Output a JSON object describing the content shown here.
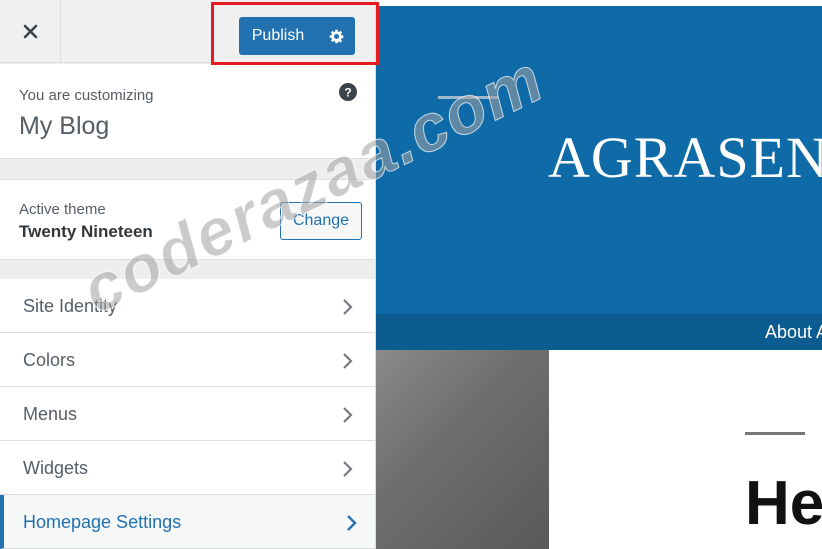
{
  "header": {
    "close_icon": "close-icon",
    "publish_label": "Publish",
    "settings_icon": "gear-icon"
  },
  "customizing": {
    "label": "You are customizing",
    "site_title": "My Blog",
    "help_icon": "question-circle-icon"
  },
  "theme": {
    "label": "Active theme",
    "name": "Twenty Nineteen",
    "change_label": "Change"
  },
  "menu": {
    "items": [
      {
        "label": "Site Identity"
      },
      {
        "label": "Colors"
      },
      {
        "label": "Menus"
      },
      {
        "label": "Widgets"
      },
      {
        "label": "Homepage Settings"
      }
    ],
    "active_index": 4,
    "chevron_icon": "chevron-right-icon"
  },
  "preview": {
    "site_name": "AGRASEN",
    "nav_link": "About A",
    "heading": "He"
  },
  "watermark": "coderazaa.com",
  "colors": {
    "accent": "#2271b1",
    "hero_blue": "#0f6aa8",
    "highlight_red": "#e51b22"
  }
}
